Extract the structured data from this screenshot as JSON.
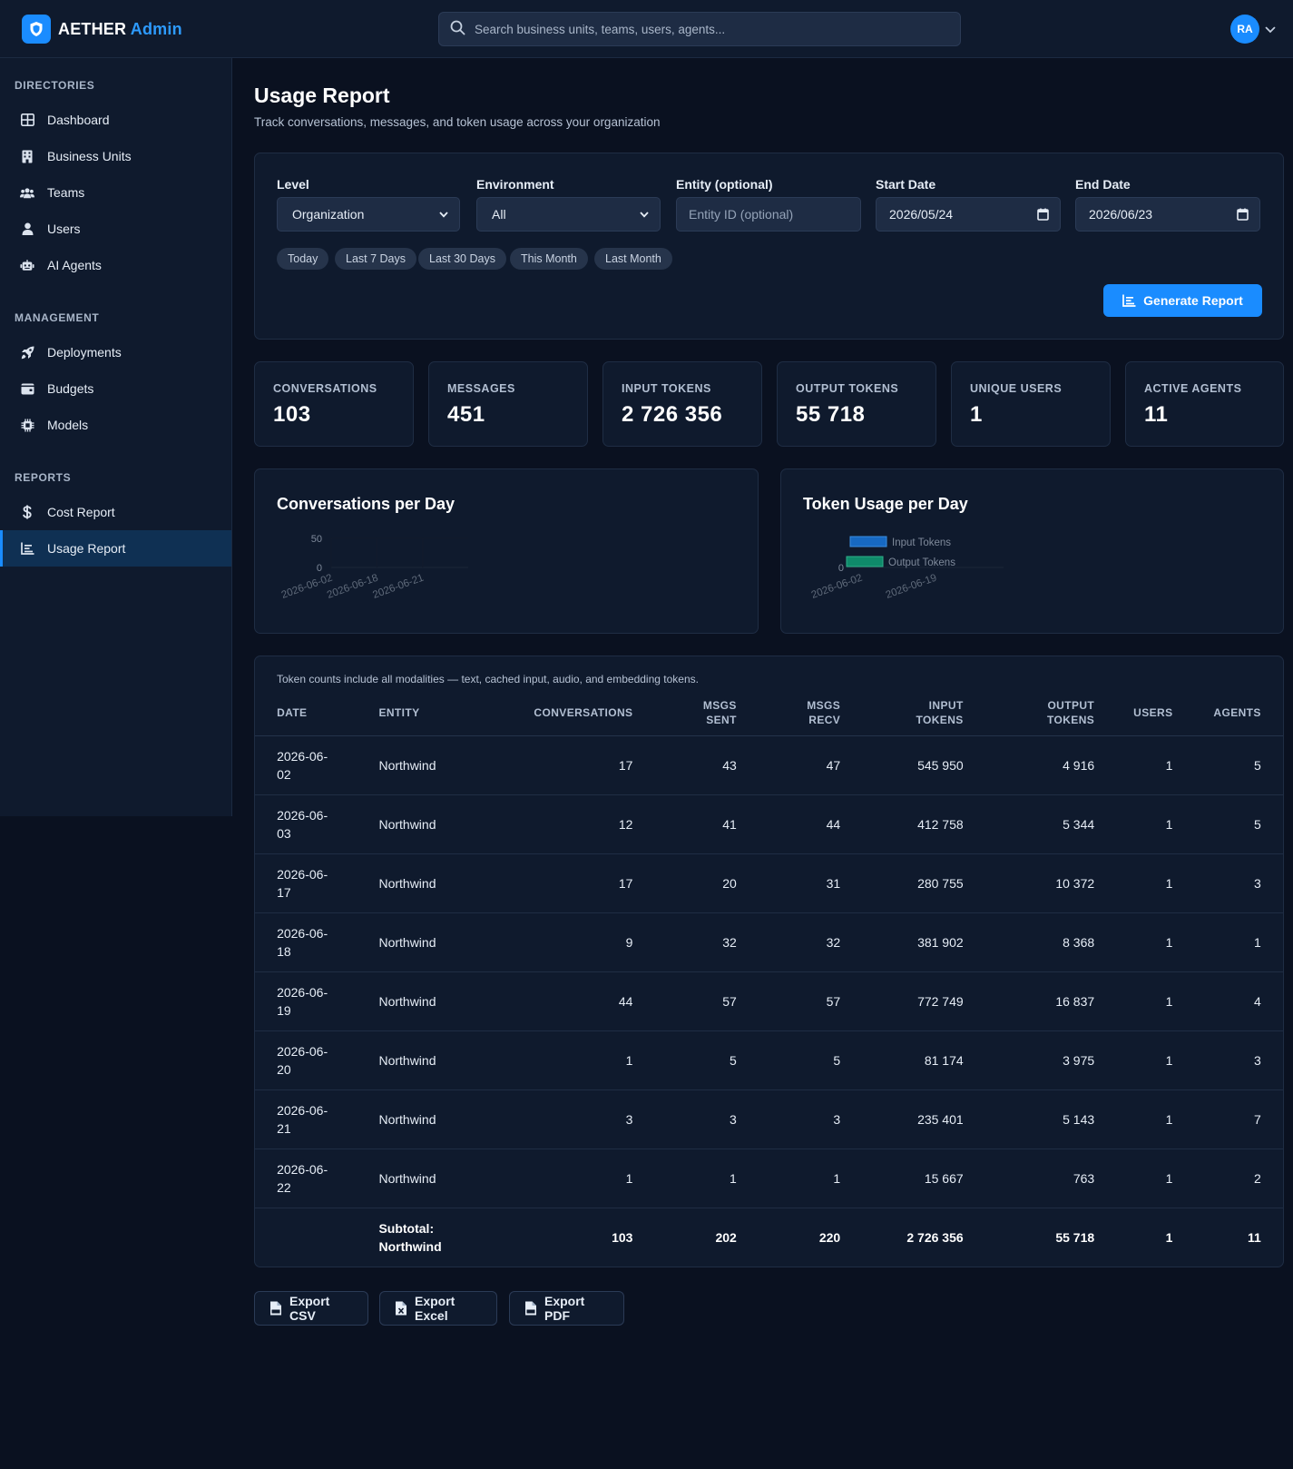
{
  "brand": {
    "name_a": "AETHER",
    "name_b": "Admin"
  },
  "search": {
    "placeholder": "Search business units, teams, users, agents..."
  },
  "user": {
    "initials": "RA"
  },
  "sidebar": {
    "sections": [
      {
        "title": "DIRECTORIES",
        "items": [
          {
            "label": "Dashboard",
            "icon": "grid-icon"
          },
          {
            "label": "Business Units",
            "icon": "building-icon"
          },
          {
            "label": "Teams",
            "icon": "users-icon"
          },
          {
            "label": "Users",
            "icon": "user-icon"
          },
          {
            "label": "AI Agents",
            "icon": "robot-icon"
          }
        ]
      },
      {
        "title": "MANAGEMENT",
        "items": [
          {
            "label": "Deployments",
            "icon": "rocket-icon"
          },
          {
            "label": "Budgets",
            "icon": "wallet-icon"
          },
          {
            "label": "Models",
            "icon": "chip-icon"
          }
        ]
      },
      {
        "title": "REPORTS",
        "items": [
          {
            "label": "Cost Report",
            "icon": "dollar-icon"
          },
          {
            "label": "Usage Report",
            "icon": "chart-icon",
            "active": true
          }
        ]
      }
    ]
  },
  "page": {
    "title": "Usage Report",
    "subtitle": "Track conversations, messages, and token usage across your organization"
  },
  "filters": {
    "level": {
      "label": "Level",
      "value": "Organization"
    },
    "environment": {
      "label": "Environment",
      "value": "All"
    },
    "entity": {
      "label": "Entity (optional)",
      "placeholder": "Entity ID (optional)"
    },
    "start_date": {
      "label": "Start Date",
      "value": "2026/05/24"
    },
    "end_date": {
      "label": "End Date",
      "value": "2026/06/23"
    },
    "presets": [
      "Today",
      "Last 7 Days",
      "Last 30 Days",
      "This Month",
      "Last Month"
    ],
    "generate_label": "Generate Report"
  },
  "stats": [
    {
      "label": "CONVERSATIONS",
      "value": "103"
    },
    {
      "label": "MESSAGES",
      "value": "451"
    },
    {
      "label": "INPUT TOKENS",
      "value": "2 726 356"
    },
    {
      "label": "OUTPUT TOKENS",
      "value": "55 718"
    },
    {
      "label": "UNIQUE USERS",
      "value": "1"
    },
    {
      "label": "ACTIVE AGENTS",
      "value": "11"
    }
  ],
  "charts": {
    "conversations_title": "Conversations per Day",
    "tokens_title": "Token Usage per Day",
    "colors": {
      "input": "#1769c2",
      "output": "#0f8a6a"
    }
  },
  "chart_data": [
    {
      "type": "bar",
      "title": "Conversations per Day",
      "categories": [
        "2026-06-02",
        "2026-06-18",
        "2026-06-21"
      ],
      "y_ticks": [
        "50",
        "0"
      ],
      "ylim": [
        0,
        50
      ],
      "series": []
    },
    {
      "type": "bar",
      "title": "Token Usage per Day",
      "categories": [
        "2026-06-02",
        "2026-06-19"
      ],
      "y_ticks": [
        "0"
      ],
      "legend_position": "top",
      "series": [
        {
          "name": "Input Tokens",
          "values": []
        },
        {
          "name": "Output Tokens",
          "values": []
        }
      ]
    }
  ],
  "table": {
    "note": "Token counts include all modalities — text, cached input, audio, and embedding tokens.",
    "headers": {
      "date": "DATE",
      "entity": "ENTITY",
      "conversations": "CONVERSATIONS",
      "msgs_sent_1": "MSGS",
      "msgs_sent_2": "SENT",
      "msgs_recv_1": "MSGS",
      "msgs_recv_2": "RECV",
      "input_1": "INPUT",
      "input_2": "TOKENS",
      "output_1": "OUTPUT",
      "output_2": "TOKENS",
      "users": "USERS",
      "agents": "AGENTS"
    },
    "rows": [
      {
        "date": "2026-06-02",
        "entity": "Northwind",
        "conversations": "17",
        "sent": "43",
        "recv": "47",
        "input": "545 950",
        "output": "4 916",
        "users": "1",
        "agents": "5"
      },
      {
        "date": "2026-06-03",
        "entity": "Northwind",
        "conversations": "12",
        "sent": "41",
        "recv": "44",
        "input": "412 758",
        "output": "5 344",
        "users": "1",
        "agents": "5"
      },
      {
        "date": "2026-06-17",
        "entity": "Northwind",
        "conversations": "17",
        "sent": "20",
        "recv": "31",
        "input": "280 755",
        "output": "10 372",
        "users": "1",
        "agents": "3"
      },
      {
        "date": "2026-06-18",
        "entity": "Northwind",
        "conversations": "9",
        "sent": "32",
        "recv": "32",
        "input": "381 902",
        "output": "8 368",
        "users": "1",
        "agents": "1"
      },
      {
        "date": "2026-06-19",
        "entity": "Northwind",
        "conversations": "44",
        "sent": "57",
        "recv": "57",
        "input": "772 749",
        "output": "16 837",
        "users": "1",
        "agents": "4"
      },
      {
        "date": "2026-06-20",
        "entity": "Northwind",
        "conversations": "1",
        "sent": "5",
        "recv": "5",
        "input": "81 174",
        "output": "3 975",
        "users": "1",
        "agents": "3"
      },
      {
        "date": "2026-06-21",
        "entity": "Northwind",
        "conversations": "3",
        "sent": "3",
        "recv": "3",
        "input": "235 401",
        "output": "5 143",
        "users": "1",
        "agents": "7"
      },
      {
        "date": "2026-06-22",
        "entity": "Northwind",
        "conversations": "1",
        "sent": "1",
        "recv": "1",
        "input": "15 667",
        "output": "763",
        "users": "1",
        "agents": "2"
      }
    ],
    "subtotal": {
      "label": "Subtotal: Northwind",
      "conversations": "103",
      "sent": "202",
      "recv": "220",
      "input": "2 726 356",
      "output": "55 718",
      "users": "1",
      "agents": "11"
    }
  },
  "exports": {
    "csv": "Export CSV",
    "excel": "Export Excel",
    "pdf": "Export PDF"
  }
}
